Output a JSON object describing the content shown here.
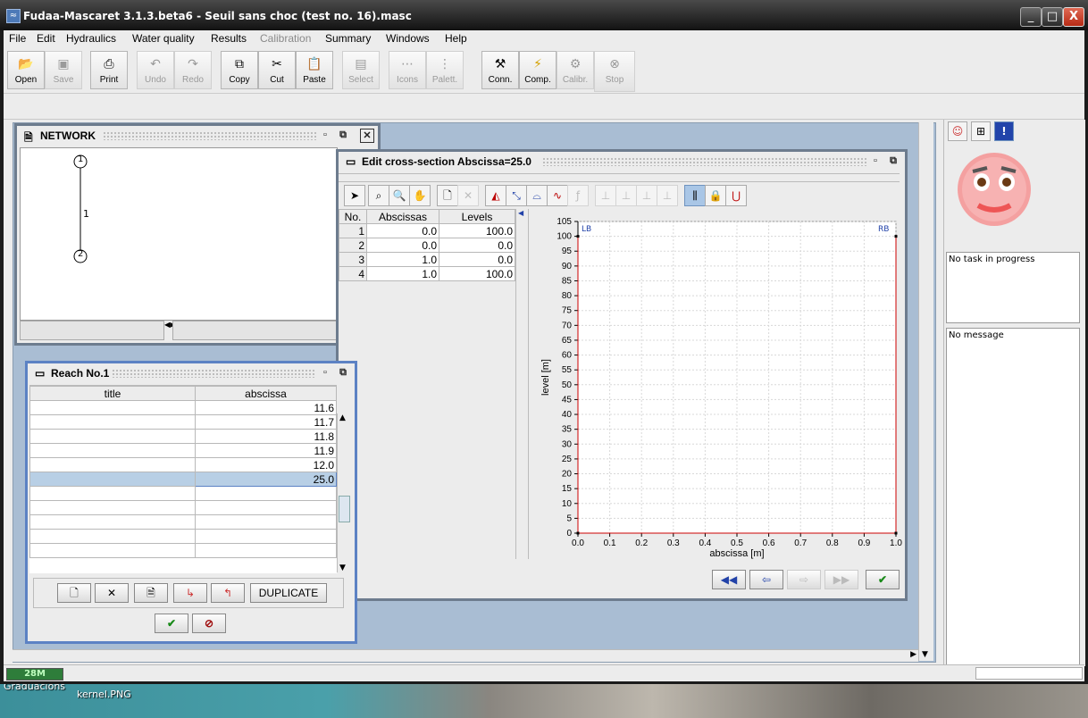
{
  "window": {
    "title": "Fudaa-Mascaret 3.1.3.beta6 - Seuil sans choc (test no. 16).masc",
    "controls": [
      "_",
      "□",
      "X"
    ]
  },
  "menu": [
    "File",
    "Edit",
    "Hydraulics",
    "Water quality",
    "Results",
    "Calibration",
    "Summary",
    "Windows",
    "Help"
  ],
  "toolbar": {
    "open": "Open",
    "save": "Save",
    "print": "Print",
    "undo": "Undo",
    "redo": "Redo",
    "copy": "Copy",
    "cut": "Cut",
    "paste": "Paste",
    "select": "Select",
    "icons": "Icons",
    "palett": "Palett.",
    "conn": "Conn.",
    "comp": "Comp.",
    "calibr": "Calibr.",
    "stop": "Stop"
  },
  "network": {
    "title": "NETWORK",
    "node1": "1",
    "node2": "2",
    "reach_label": "1"
  },
  "reach": {
    "title": "Reach No.1",
    "columns": [
      "title",
      "abscissa"
    ],
    "rows": [
      "11.6",
      "11.7",
      "11.8",
      "11.9",
      "12.0",
      "25.0"
    ],
    "duplicate": "DUPLICATE"
  },
  "crosssection": {
    "title": "Edit cross-section  Abscissa=25.0",
    "columns": [
      "No.",
      "Abscissas",
      "Levels"
    ],
    "rows": [
      {
        "no": "1",
        "abscissa": "0.0",
        "level": "100.0"
      },
      {
        "no": "2",
        "abscissa": "0.0",
        "level": "0.0"
      },
      {
        "no": "3",
        "abscissa": "1.0",
        "level": "0.0"
      },
      {
        "no": "4",
        "abscissa": "1.0",
        "level": "100.0"
      }
    ]
  },
  "chart_data": {
    "type": "line",
    "xlabel": "abscissa [m]",
    "ylabel": "level [m]",
    "xlim": [
      0.0,
      1.0
    ],
    "ylim": [
      0,
      105
    ],
    "x_ticks": [
      "0.0",
      "0.1",
      "0.2",
      "0.3",
      "0.4",
      "0.5",
      "0.6",
      "0.7",
      "0.8",
      "0.9",
      "1.0"
    ],
    "y_ticks": [
      "0",
      "5",
      "10",
      "15",
      "20",
      "25",
      "30",
      "35",
      "40",
      "45",
      "50",
      "55",
      "60",
      "65",
      "70",
      "75",
      "80",
      "85",
      "90",
      "95",
      "100",
      "105"
    ],
    "grid": true,
    "annotations": [
      "LB",
      "RB"
    ],
    "series": [
      {
        "x": [
          0.0,
          0.0,
          1.0,
          1.0
        ],
        "y": [
          100,
          0,
          0,
          100
        ],
        "color": "#cc0000"
      }
    ]
  },
  "right_panel": {
    "task": "No task in progress",
    "message": "No message"
  },
  "status": {
    "memory": "28M"
  },
  "desktop": {
    "label1": "Graduacions",
    "label2": "kernel.PNG"
  }
}
